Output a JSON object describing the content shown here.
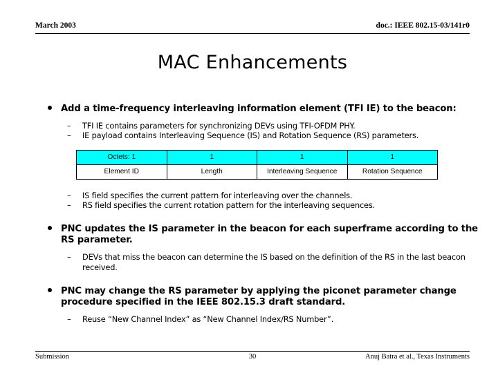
{
  "header": {
    "date": "March 2003",
    "doc": "doc.: IEEE 802.15-03/141r0"
  },
  "title": "MAC Enhancements",
  "content": {
    "bullet1": {
      "text": "Add a time-frequency interleaving information element (TFI IE) to the beacon:",
      "subs": [
        "TFI IE contains parameters for synchronizing DEVs using TFI-OFDM PHY.",
        "IE payload contains Interleaving Sequence (IS) and Rotation Sequence (RS) parameters."
      ]
    },
    "table": {
      "header_row": [
        "Octets: 1",
        "1",
        "1",
        "1"
      ],
      "label_row": [
        "Element ID",
        "Length",
        "Interleaving Sequence",
        "Rotation Sequence"
      ],
      "header_bg": "#00ffff",
      "label_bg": "#ffffff",
      "border_color": "#000000"
    },
    "bullet1_after_table_subs": [
      "IS field specifies the current pattern for interleaving over the channels.",
      "RS field specifies the current rotation pattern for the interleaving sequences."
    ],
    "bullet2": {
      "text": "PNC updates the IS parameter in the beacon for each superframe according to the RS parameter.",
      "subs": [
        "DEVs that miss the beacon can determine the IS based on the definition of the RS in the last beacon received."
      ]
    },
    "bullet3": {
      "text": "PNC may change the RS parameter by applying the piconet parameter change procedure specified in the IEEE 802.15.3 draft standard.",
      "subs": [
        "Reuse “New Channel Index” as “New Channel Index/RS Number”."
      ]
    },
    "dash_marker": "–"
  },
  "footer": {
    "left": "Submission",
    "page": "30",
    "right": "Anuj Batra et al., Texas Instruments"
  }
}
